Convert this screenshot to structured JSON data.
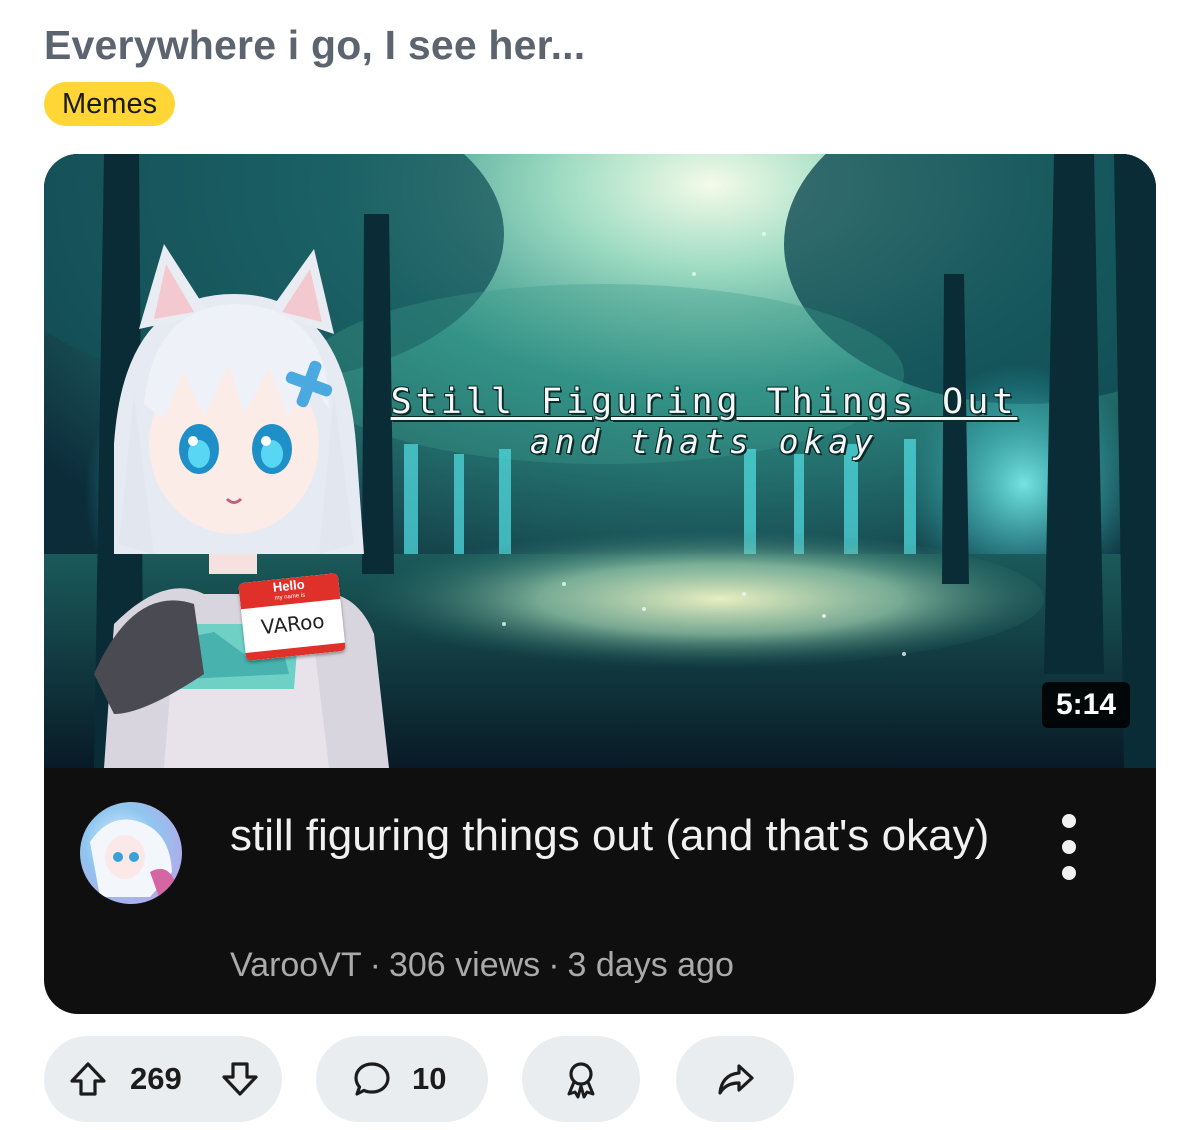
{
  "post": {
    "title": "Everywhere i go, I see her...",
    "flair": "Memes"
  },
  "video": {
    "thumbnail_text_line1": "Still Figuring Things Out",
    "thumbnail_text_line2": "and thats okay",
    "name_tag_header": "Hello",
    "name_tag_subheader": "my name is",
    "name_tag_name": "VARoo",
    "duration": "5:14",
    "title": "still figuring things out (and that's okay)",
    "channel": "VarooVT",
    "views": "306 views",
    "age": "3 days ago",
    "separator": "·"
  },
  "actions": {
    "votes": "269",
    "comments": "10",
    "upvote_icon": "upvote-arrow-icon",
    "downvote_icon": "downvote-arrow-icon",
    "comment_icon": "speech-bubble-icon",
    "award_icon": "award-ribbon-icon",
    "share_icon": "share-arrow-icon"
  },
  "colors": {
    "flair_bg": "#ffd635",
    "title_text": "#5c6470",
    "card_bg": "#0f0f0f",
    "pill_bg": "#eaedef"
  }
}
